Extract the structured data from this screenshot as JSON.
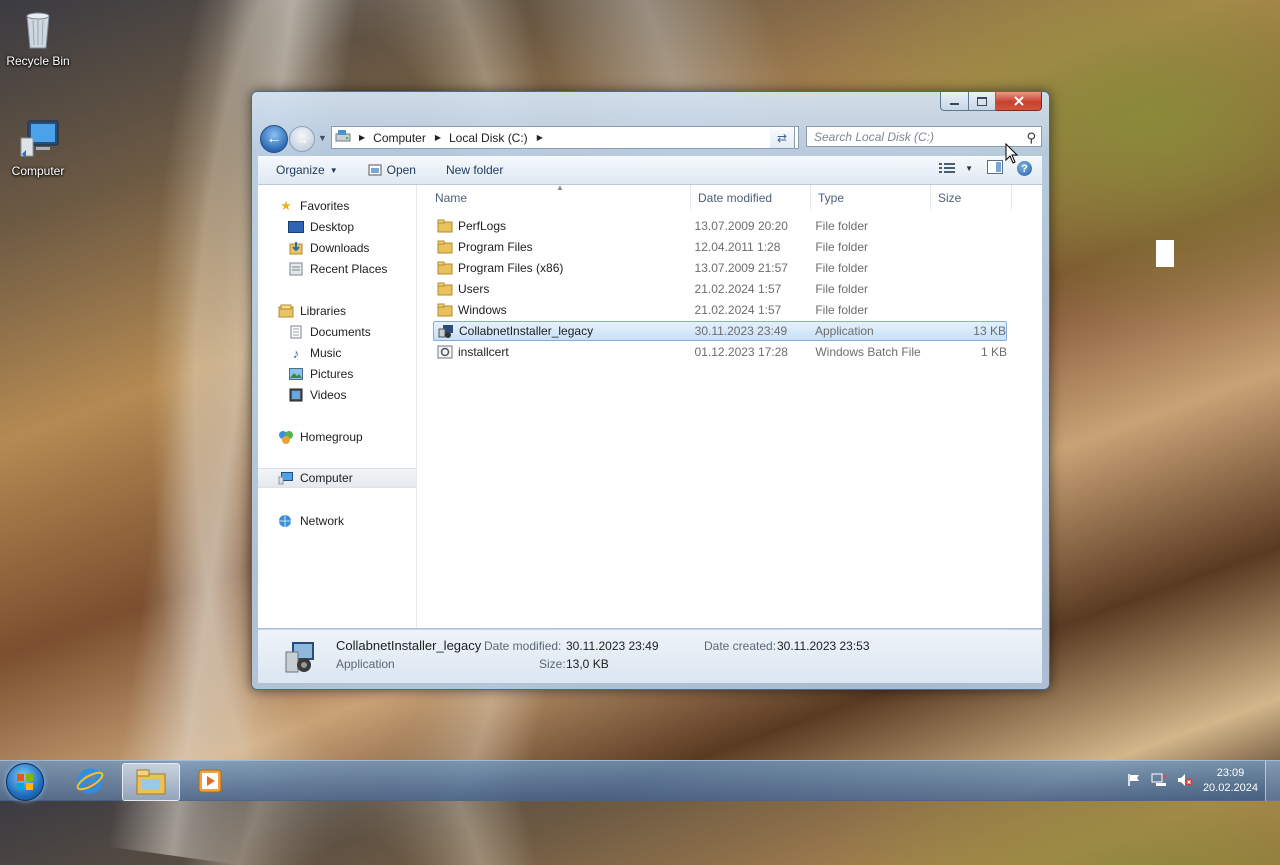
{
  "desktop": {
    "icons": [
      {
        "label": "Recycle Bin",
        "icon": "recycle-bin-icon"
      },
      {
        "label": "Computer",
        "icon": "computer-icon"
      }
    ]
  },
  "window": {
    "address": {
      "segments": [
        "Computer",
        "Local Disk (C:)"
      ]
    },
    "search": {
      "placeholder": "Search Local Disk (C:)"
    },
    "toolbar": {
      "organize": "Organize",
      "open": "Open",
      "new_folder": "New folder"
    },
    "nav": {
      "favorites": {
        "label": "Favorites",
        "items": [
          "Desktop",
          "Downloads",
          "Recent Places"
        ]
      },
      "libraries": {
        "label": "Libraries",
        "items": [
          "Documents",
          "Music",
          "Pictures",
          "Videos"
        ]
      },
      "homegroup": "Homegroup",
      "computer": "Computer",
      "network": "Network"
    },
    "columns": {
      "name": "Name",
      "date": "Date modified",
      "type": "Type",
      "size": "Size"
    },
    "files": [
      {
        "name": "PerfLogs",
        "date": "13.07.2009 20:20",
        "type": "File folder",
        "size": "",
        "icon": "folder-icon"
      },
      {
        "name": "Program Files",
        "date": "12.04.2011 1:28",
        "type": "File folder",
        "size": "",
        "icon": "folder-icon"
      },
      {
        "name": "Program Files (x86)",
        "date": "13.07.2009 21:57",
        "type": "File folder",
        "size": "",
        "icon": "folder-icon"
      },
      {
        "name": "Users",
        "date": "21.02.2024 1:57",
        "type": "File folder",
        "size": "",
        "icon": "folder-icon"
      },
      {
        "name": "Windows",
        "date": "21.02.2024 1:57",
        "type": "File folder",
        "size": "",
        "icon": "folder-icon"
      },
      {
        "name": "CollabnetInstaller_legacy",
        "date": "30.11.2023 23:49",
        "type": "Application",
        "size": "13 KB",
        "icon": "application-icon",
        "selected": true
      },
      {
        "name": "installcert",
        "date": "01.12.2023 17:28",
        "type": "Windows Batch File",
        "size": "1 KB",
        "icon": "batch-file-icon"
      }
    ],
    "details": {
      "name": "CollabnetInstaller_legacy",
      "type": "Application",
      "date_modified_label": "Date modified:",
      "date_modified": "30.11.2023 23:49",
      "date_created_label": "Date created:",
      "date_created": "30.11.2023 23:53",
      "size_label": "Size:",
      "size": "13,0 KB"
    }
  },
  "taskbar": {
    "clock_time": "23:09",
    "clock_date": "20.02.2024"
  }
}
